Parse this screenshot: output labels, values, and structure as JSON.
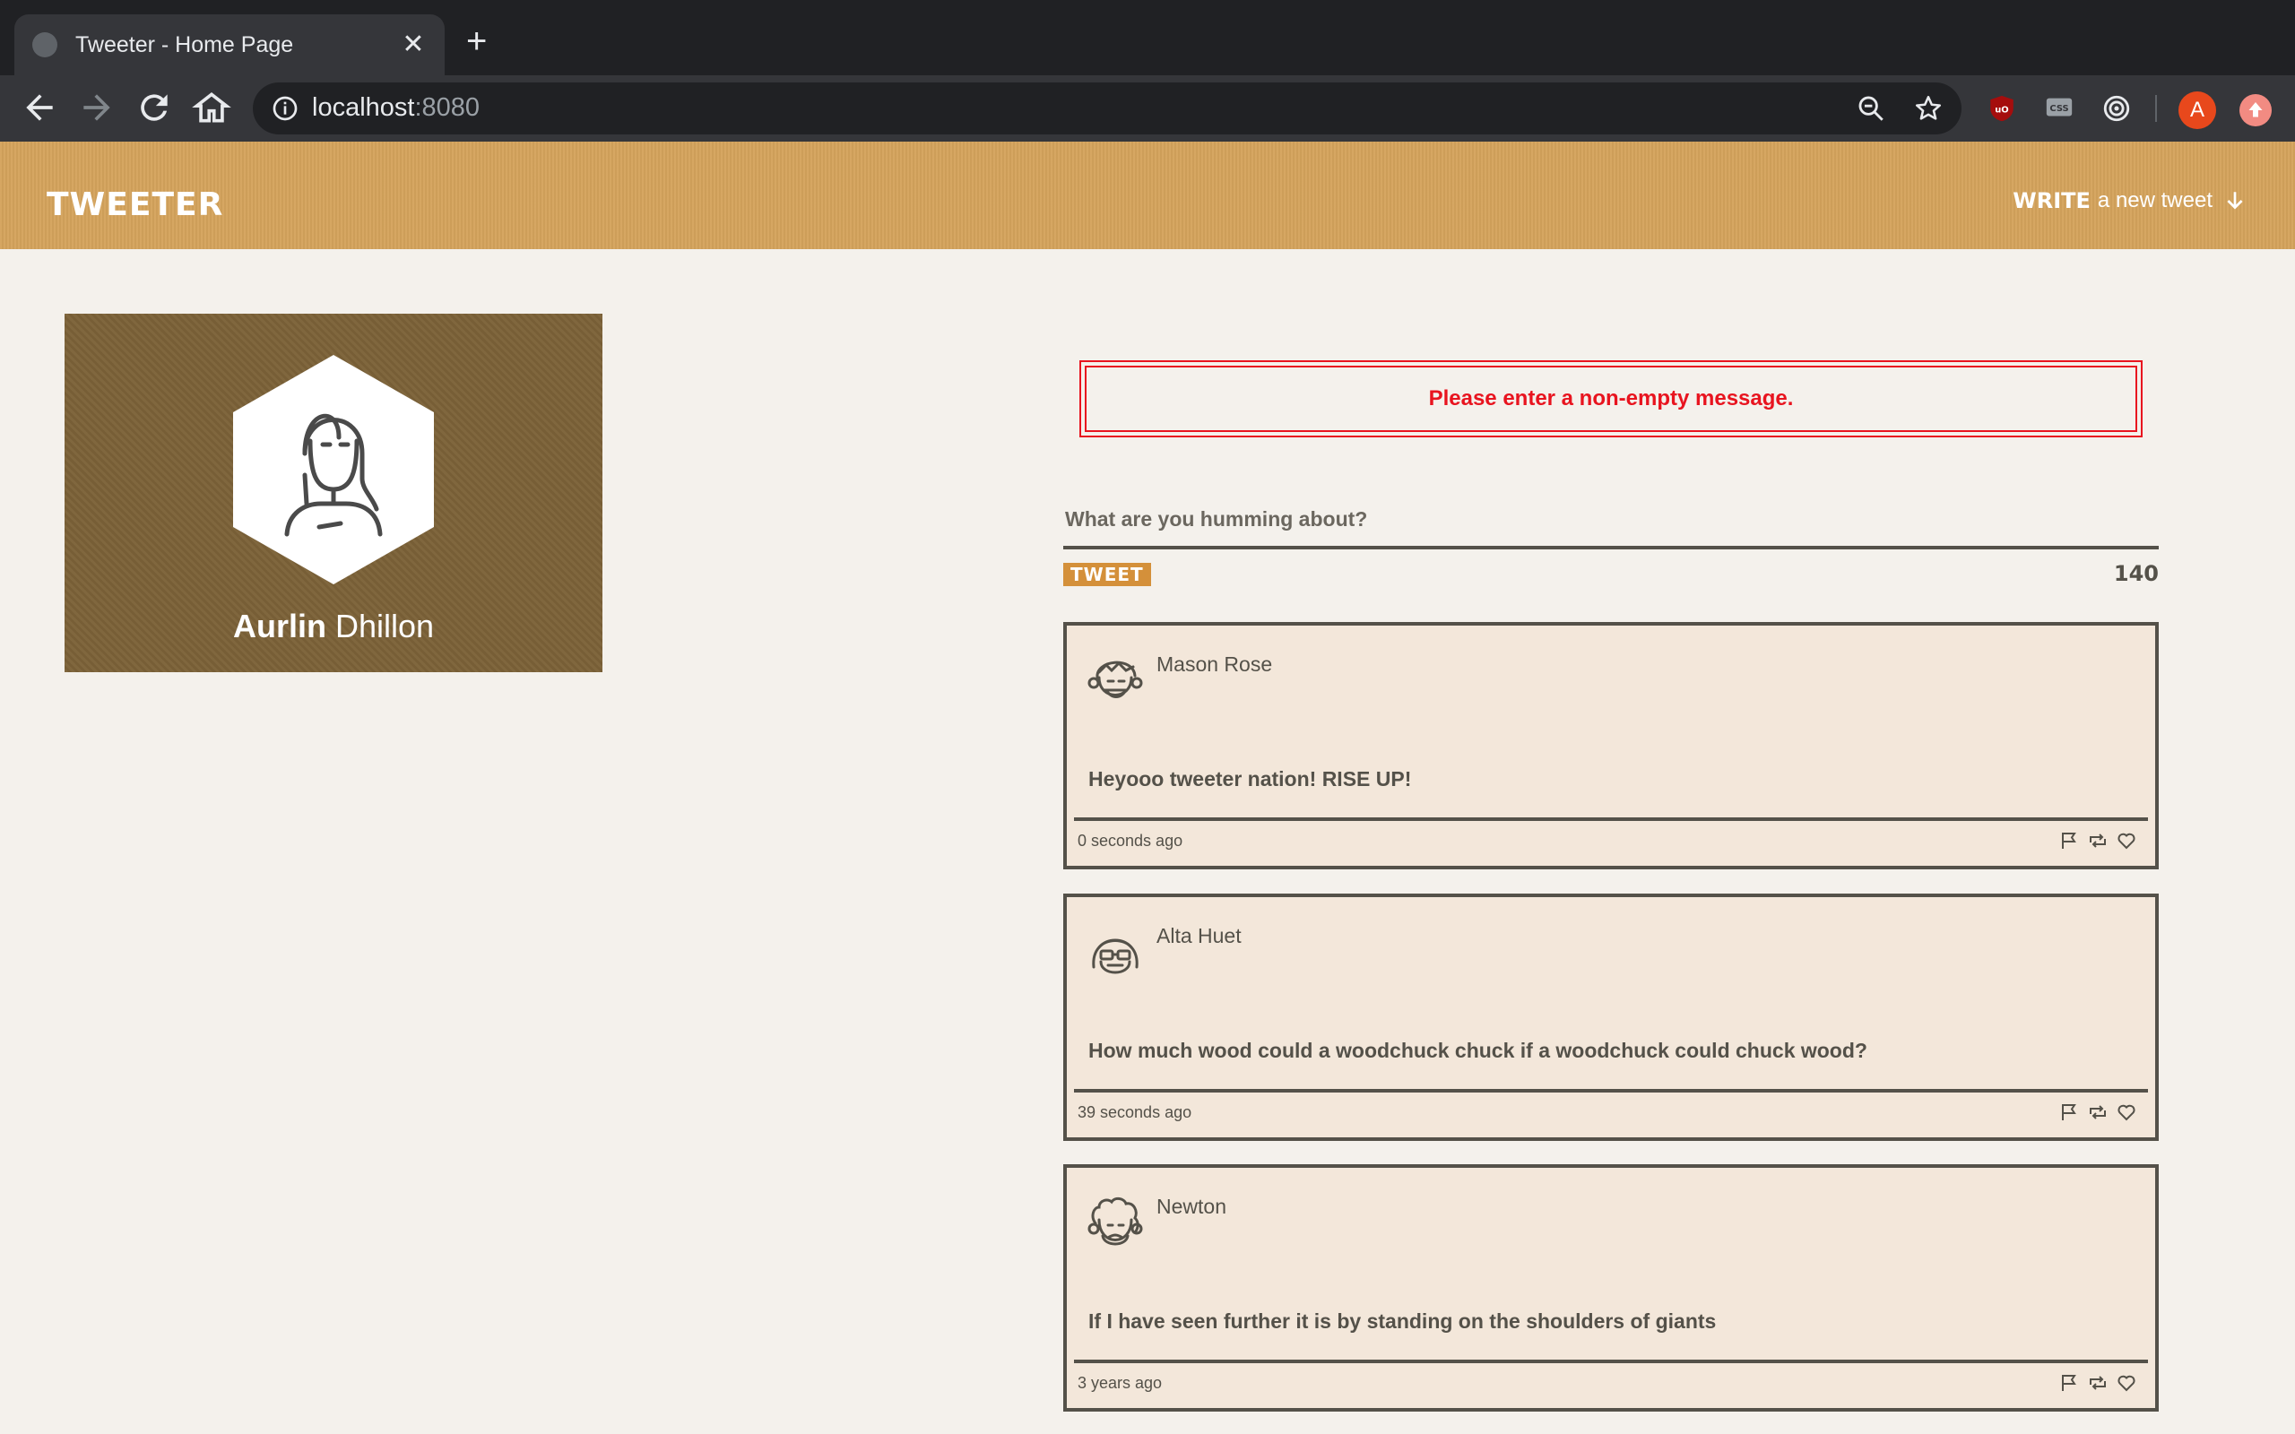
{
  "browser": {
    "tab_title": "Tweeter - Home Page",
    "url_host": "localhost",
    "url_port": ":8080",
    "profile_initial": "A"
  },
  "header": {
    "brand": "TWEETER",
    "compose_strong": "WRITE",
    "compose_rest": "a new tweet"
  },
  "profile": {
    "first_name": "Aurlin",
    "last_name": "Dhillon"
  },
  "error": {
    "message": "Please enter a non-empty message."
  },
  "composer": {
    "placeholder": "What are you humming about?",
    "button_label": "TWEET",
    "counter": "140"
  },
  "tweets": [
    {
      "author": "Mason Rose",
      "text": "Heyooo tweeter nation! RISE UP!",
      "time": "0 seconds ago"
    },
    {
      "author": "Alta Huet",
      "text": "How much wood could a woodchuck chuck if a woodchuck could chuck wood?",
      "time": "39 seconds ago"
    },
    {
      "author": "Newton",
      "text": "If I have seen further it is by standing on the shoulders of giants",
      "time": "3 years ago"
    }
  ],
  "colors": {
    "header": "#d4a35c",
    "profile_card": "#7c6238",
    "error": "#e8141f",
    "ink": "#545149",
    "tweet_bg": "#f3e7da",
    "tweet_button": "#d4903a"
  }
}
